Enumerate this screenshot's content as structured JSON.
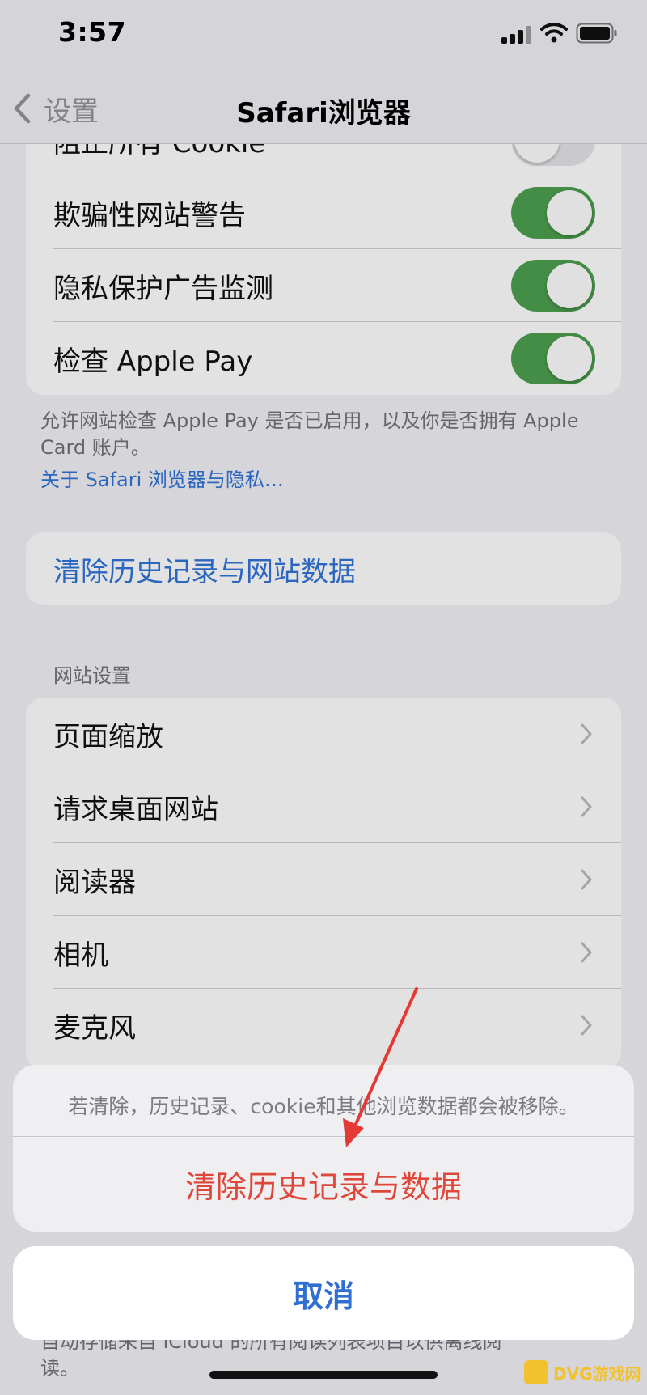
{
  "status_bar": {
    "time": "3:57"
  },
  "nav": {
    "back_label": "设置",
    "title": "Safari浏览器"
  },
  "privacy_group": {
    "rows": [
      {
        "label": "阻止所有 Cookie",
        "toggle": "off"
      },
      {
        "label": "欺骗性网站警告",
        "toggle": "on"
      },
      {
        "label": "隐私保护广告监测",
        "toggle": "on"
      },
      {
        "label": "检查 Apple Pay",
        "toggle": "on"
      }
    ],
    "footnote": "允许网站检查 Apple Pay 是否已启用，以及你是否拥有 Apple Card 账户。",
    "footnote_link": "关于 Safari 浏览器与隐私…"
  },
  "clear_group": {
    "label": "清除历史记录与网站数据"
  },
  "website_settings": {
    "header": "网站设置",
    "rows": [
      {
        "label": "页面缩放"
      },
      {
        "label": "请求桌面网站"
      },
      {
        "label": "阅读器"
      },
      {
        "label": "相机"
      },
      {
        "label": "麦克风"
      }
    ]
  },
  "bottom_footnote": "自动存储来自 iCloud 的所有阅读列表项目以供离线阅读。",
  "action_sheet": {
    "message": "若清除，历史记录、cookie和其他浏览数据都会被移除。",
    "destructive_label": "清除历史记录与数据",
    "cancel_label": "取消"
  },
  "colors": {
    "toggle_on": "#4a9a4c",
    "link_blue": "#2f6fd0",
    "destructive_red": "#e0473b"
  },
  "watermark": {
    "text": "DVG游戏网"
  }
}
